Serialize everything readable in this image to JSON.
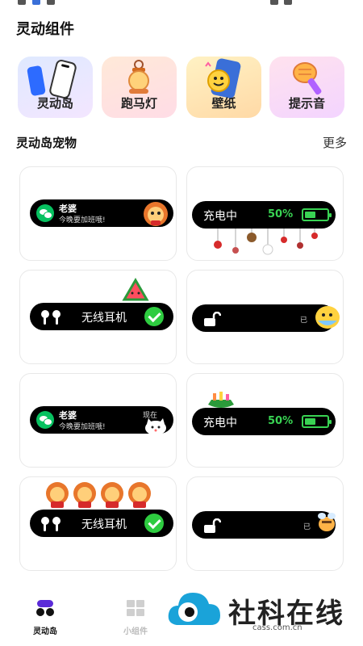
{
  "components": {
    "title": "灵动组件",
    "cards": [
      {
        "label": "灵动岛"
      },
      {
        "label": "跑马灯"
      },
      {
        "label": "壁纸"
      },
      {
        "label": "提示音"
      }
    ]
  },
  "pets": {
    "title": "灵动岛宠物",
    "more": "更多",
    "cards": [
      {
        "name": "老婆",
        "message": "今晚要加班哦!"
      },
      {
        "label": "充电中",
        "percent": "50%",
        "level": 0.5
      },
      {
        "label": "无线耳机"
      },
      {
        "status": "已"
      },
      {
        "name": "老婆",
        "message": "今晚要加班哦!",
        "tag": "现在"
      },
      {
        "label": "充电中",
        "percent": "50%",
        "level": 0.5
      },
      {
        "label": "无线耳机"
      },
      {
        "status": "已"
      }
    ]
  },
  "tabs": [
    {
      "label": "灵动岛",
      "icon": "island-icon"
    },
    {
      "label": "小组件",
      "icon": "widget-grid-icon"
    }
  ],
  "watermark": {
    "brand": "社科在线",
    "url": "cass.com.cn"
  },
  "colors": {
    "accent": "#39d353",
    "wechat": "#07c160",
    "pill": "#000000"
  }
}
